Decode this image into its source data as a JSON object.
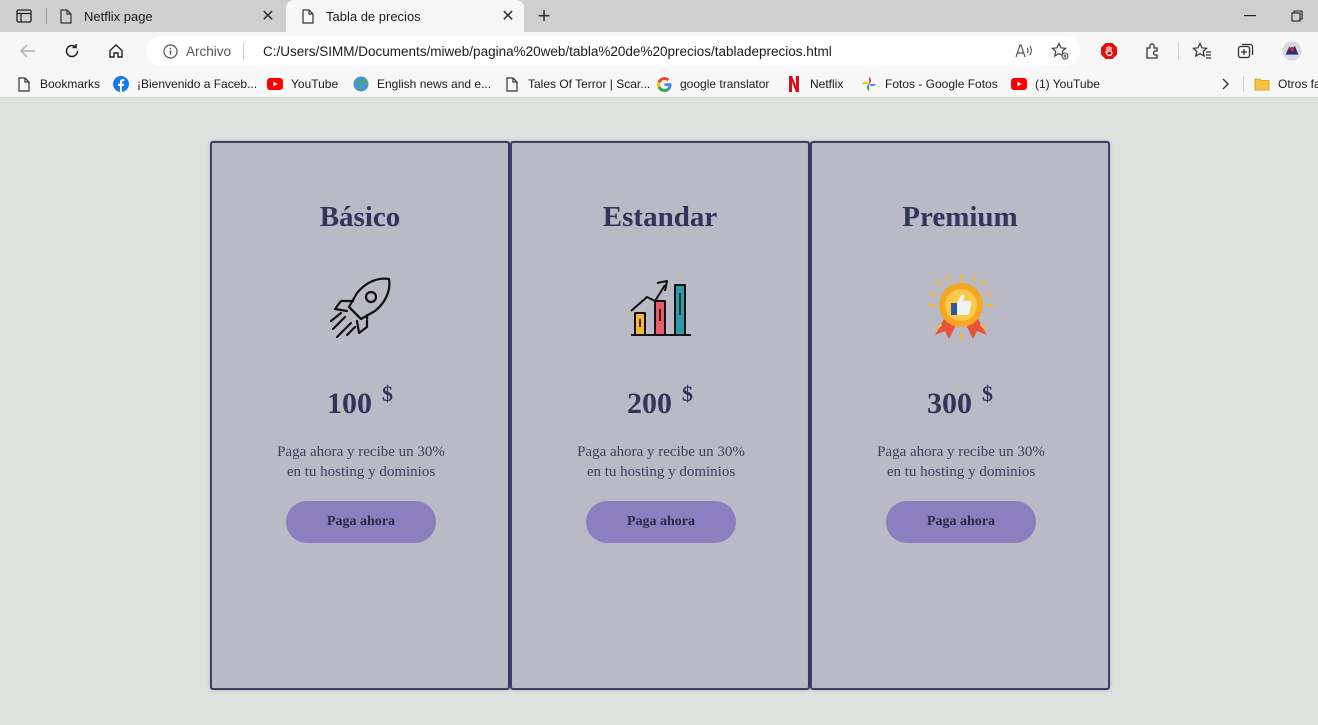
{
  "browser": {
    "tabs": [
      {
        "label": "Netflix page"
      },
      {
        "label": "Tabla de precios"
      }
    ],
    "address": {
      "scheme_label": "Archivo",
      "url": "C:/Users/SIMM/Documents/miweb/pagina%20web/tabla%20de%20precios/tabladeprecios.html"
    },
    "bookmarks": [
      {
        "label": "Bookmarks"
      },
      {
        "label": "¡Bienvenido a Faceb..."
      },
      {
        "label": "YouTube"
      },
      {
        "label": "English news and e..."
      },
      {
        "label": "Tales Of Terror | Scar..."
      },
      {
        "label": "google translator"
      },
      {
        "label": "Netflix"
      },
      {
        "label": "Fotos - Google Fotos"
      },
      {
        "label": "(1) YouTube"
      },
      {
        "label": "Otros fa"
      }
    ]
  },
  "pricing": {
    "currency": "$",
    "plans": [
      {
        "name": "Básico",
        "price": "100",
        "icon": "rocket-icon",
        "desc_line1": "Paga ahora y recibe un 30%",
        "desc_line2": "en tu hosting y dominios",
        "button": "Paga ahora"
      },
      {
        "name": "Estandar",
        "price": "200",
        "icon": "growth-chart-icon",
        "desc_line1": "Paga ahora y recibe un 30%",
        "desc_line2": "en tu hosting y dominios",
        "button": "Paga ahora"
      },
      {
        "name": "Premium",
        "price": "300",
        "icon": "award-badge-icon",
        "desc_line1": "Paga ahora y recibe un 30%",
        "desc_line2": "en tu hosting y dominios",
        "button": "Paga ahora"
      }
    ]
  },
  "colors": {
    "card_bg": "#babac6",
    "card_border": "#3d3d66",
    "title": "#33345c",
    "button": "#8c7fbf",
    "page_bg": "#dfe1df"
  }
}
